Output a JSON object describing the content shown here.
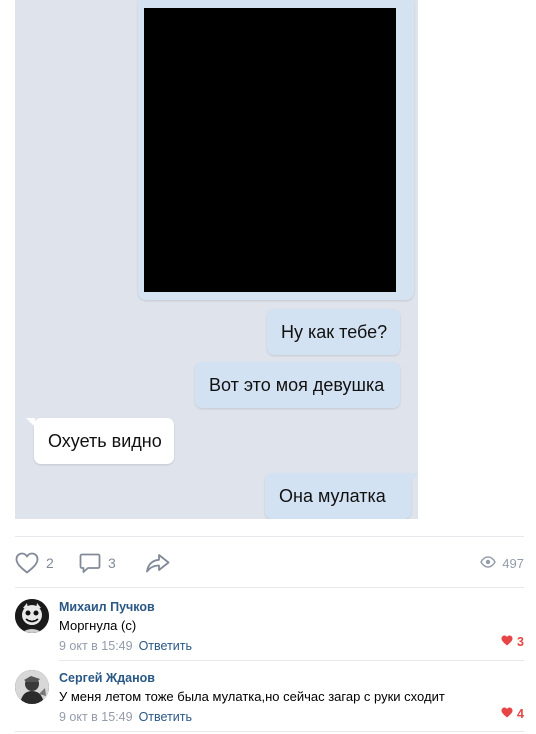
{
  "chat": {
    "messages": [
      {
        "text": "Ну как тебе?",
        "side": "out"
      },
      {
        "text": "Вот это моя девушка",
        "side": "out"
      },
      {
        "text": "Охуеть видно",
        "side": "in"
      },
      {
        "text": "Она мулатка",
        "side": "out"
      }
    ]
  },
  "post_actions": {
    "likes": "2",
    "comments": "3",
    "views": "497"
  },
  "comments": [
    {
      "author": "Михаил Пучков",
      "text": "Моргнула (с)",
      "date": "9 окт в 15:49",
      "reply_label": "Ответить",
      "likes": "3"
    },
    {
      "author": "Сергей Жданов",
      "text": "У меня летом тоже была мулатка,но сейчас загар с руки сходит",
      "date": "9 окт в 15:49",
      "reply_label": "Ответить",
      "likes": "4"
    }
  ],
  "colors": {
    "chat_bg": "#dfe4ec",
    "outgoing_bubble": "#d3e2f3",
    "incoming_bubble": "#ffffff",
    "link": "#2a5885",
    "like_red": "#e64646",
    "muted": "#828a99"
  }
}
